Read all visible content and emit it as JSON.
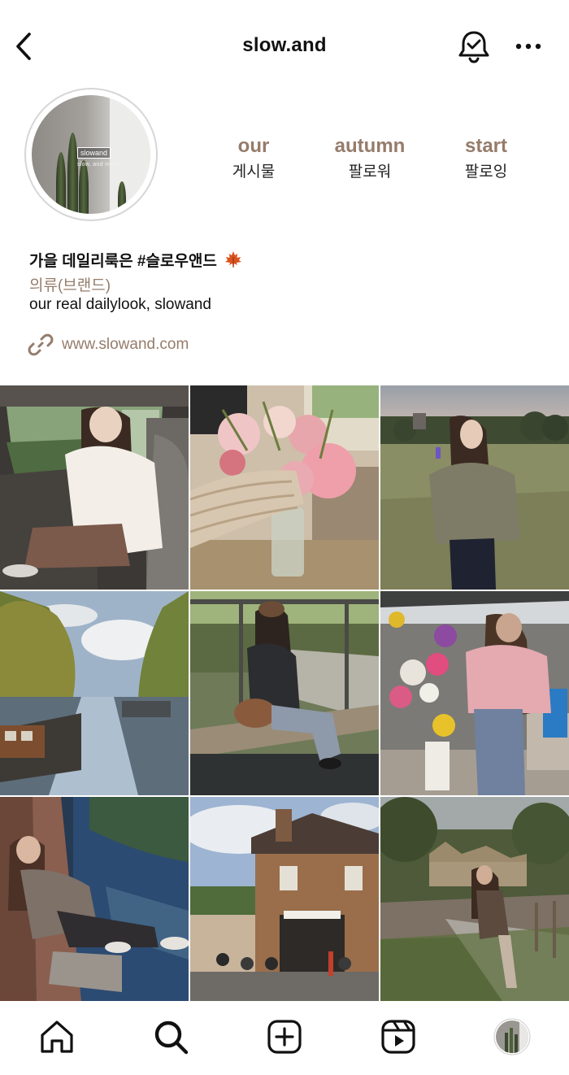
{
  "header": {
    "username": "slow.and",
    "back_icon": "chevron-left-icon",
    "bell_icon": "bell-check-icon",
    "more_icon": "more-horizontal-icon"
  },
  "avatar": {
    "tag": "slowand",
    "subtext": "slow, and more"
  },
  "stats": [
    {
      "value": "our",
      "label": "게시물"
    },
    {
      "value": "autumn",
      "label": "팔로워"
    },
    {
      "value": "start",
      "label": "팔로잉"
    }
  ],
  "bio": {
    "name": "가을 데일리룩은 #슬로우앤드",
    "category": "의류(브랜드)",
    "description": "our real dailylook, slowand",
    "link": "www.slowand.com",
    "link_icon": "link-icon"
  },
  "colors": {
    "accent": "#957c6b",
    "text": "#111111",
    "divider": "#d6d6d6"
  },
  "grid_posts": [
    {
      "scene": "girl in white shirt sitting in car"
    },
    {
      "scene": "hand holding vase of pink peonies"
    },
    {
      "scene": "girl in green sweater in meadow at dusk"
    },
    {
      "scene": "canal with boats and autumn trees"
    },
    {
      "scene": "girl sitting on bridge edge in beanie"
    },
    {
      "scene": "girl in pink sweater at flower market"
    },
    {
      "scene": "girl sitting by canal taking photo"
    },
    {
      "scene": "brick corner shop with outdoor cafe"
    },
    {
      "scene": "girl walking on village path by stone wall"
    }
  ],
  "tabbar": {
    "items": [
      "home-icon",
      "search-icon",
      "add-post-icon",
      "reels-icon",
      "profile-avatar"
    ]
  }
}
